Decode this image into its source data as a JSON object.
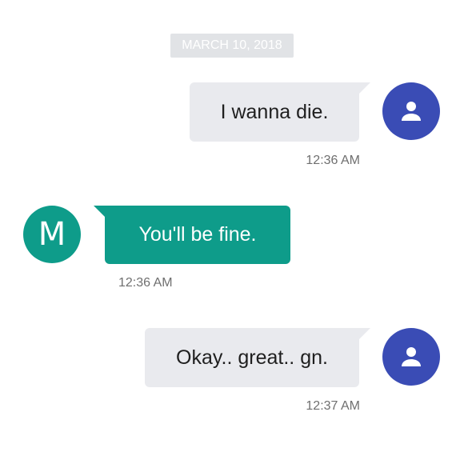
{
  "date_divider": "MARCH 10, 2018",
  "messages": [
    {
      "direction": "sent",
      "text": "I wanna die.",
      "time": "12:36 AM"
    },
    {
      "direction": "received",
      "text": "You'll be fine.",
      "time": "12:36 AM",
      "avatar_letter": "M"
    },
    {
      "direction": "sent",
      "text": "Okay.. great.. gn.",
      "time": "12:37 AM"
    }
  ],
  "icons": {
    "user_avatar": "person-icon"
  },
  "colors": {
    "sent_bubble": "#e9eaee",
    "received_bubble": "#0e9c8a",
    "user_avatar": "#3a4cb5",
    "contact_avatar": "#0e9c8a",
    "date_chip": "#e1e3e6",
    "timestamp_text": "#6f6f6f"
  }
}
